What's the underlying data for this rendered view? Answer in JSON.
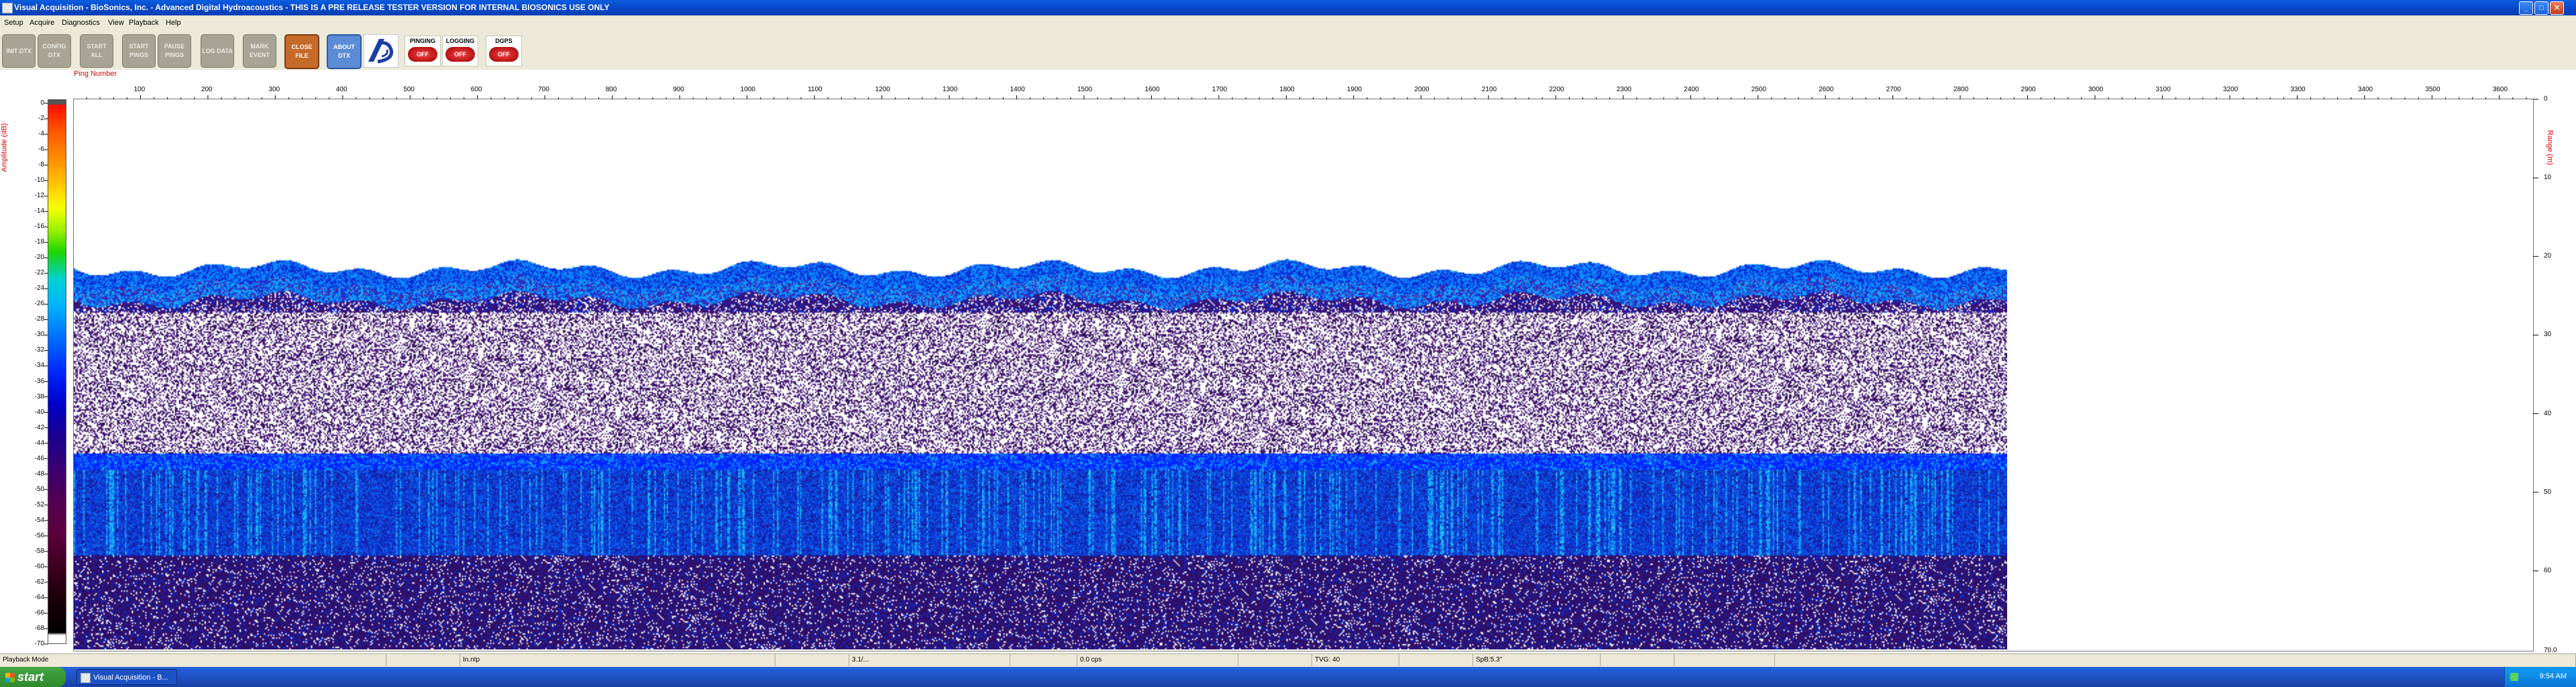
{
  "window": {
    "title": "Visual Acquisition  -  BioSonics, Inc.  -  Advanced Digital Hydroacoustics  -  THIS IS A PRE RELEASE TESTER VERSION FOR INTERNAL BIOSONICS USE ONLY",
    "minimize_icon": "minimize-icon",
    "maximize_icon": "maximize-icon",
    "close_icon": "close-icon"
  },
  "menu": [
    "Setup",
    "Acquire",
    "Diagnostics",
    "View",
    "Playback",
    "Help"
  ],
  "toolbar": {
    "buttons": [
      {
        "label": "INIT DTX"
      },
      {
        "label": "CONFIG DTX"
      },
      {
        "label": "START ALL"
      },
      {
        "label": "START PINGS"
      },
      {
        "label": "PAUSE PINGS"
      },
      {
        "label": "LOG DATA"
      },
      {
        "label": "MARK EVENT"
      },
      {
        "label": "CLOSE FILE"
      },
      {
        "label": "ABOUT DTX"
      }
    ],
    "logo_icon": "biosonics-logo-icon",
    "status": [
      {
        "label": "PINGING",
        "state": "OFF"
      },
      {
        "label": "LOGGING",
        "state": "OFF"
      },
      {
        "label": "DGPS",
        "state": "OFF"
      }
    ]
  },
  "chart_data": {
    "type": "heatmap",
    "title": "",
    "xlabel": "Ping Number",
    "ylabel_left": "Amplitude (dB)",
    "ylabel_right": "Range (m)",
    "x_range": [
      1,
      3650
    ],
    "x_ticks": [
      100,
      200,
      300,
      400,
      500,
      600,
      700,
      800,
      900,
      1000,
      1100,
      1200,
      1300,
      1400,
      1500,
      1600,
      1700,
      1800,
      1900,
      2000,
      2100,
      2200,
      2300,
      2400,
      2500,
      2600,
      2700,
      2800,
      2900,
      3000,
      3100,
      3200,
      3300,
      3400,
      3500,
      3600
    ],
    "range_ticks": [
      0,
      10,
      20,
      30,
      40,
      50,
      60
    ],
    "range_max_label": "70.0",
    "range_limits": [
      0,
      70
    ],
    "data_last_ping": 2870,
    "colorbar": {
      "min_db": -70,
      "max_db": 0,
      "ticks": [
        0,
        -2,
        -4,
        -6,
        -8,
        -10,
        -12,
        -14,
        -16,
        -18,
        -20,
        -22,
        -24,
        -26,
        -28,
        -30,
        -32,
        -34,
        -36,
        -38,
        -40,
        -42,
        -44,
        -46,
        -48,
        -50,
        -52,
        -54,
        -56,
        -58,
        -60,
        -62,
        -64,
        -66,
        -68,
        -70
      ]
    },
    "layers": [
      {
        "kind": "surface_band",
        "range_m": [
          21.5,
          23.5
        ],
        "color": "#0a2fd6"
      },
      {
        "kind": "surface_band_inner",
        "range_m": [
          23.5,
          25.5
        ],
        "color": "#12a4ff"
      },
      {
        "kind": "sparse_noise",
        "range_m": [
          27,
          45
        ],
        "color": "#4a1b7a"
      },
      {
        "kind": "bottom_edge",
        "range_m": [
          45,
          47
        ],
        "color": "#0025ff"
      },
      {
        "kind": "bottom_echo",
        "range_m": [
          47,
          58
        ],
        "color": "#0b3cd8"
      },
      {
        "kind": "deep_noise",
        "range_m": [
          58,
          70
        ],
        "color": "#2a1272"
      }
    ]
  },
  "statusbar": {
    "fields": [
      "Playback Mode",
      "",
      "In.ntp",
      "",
      "3.1/...",
      "",
      "0.0 cps",
      "",
      "TVG: 40",
      "",
      "SpB:5.3\"",
      "",
      "",
      ""
    ]
  },
  "taskbar": {
    "start_label": "start",
    "task_label": "Visual Acquisition  -  B...",
    "clock": "9:54 AM"
  }
}
